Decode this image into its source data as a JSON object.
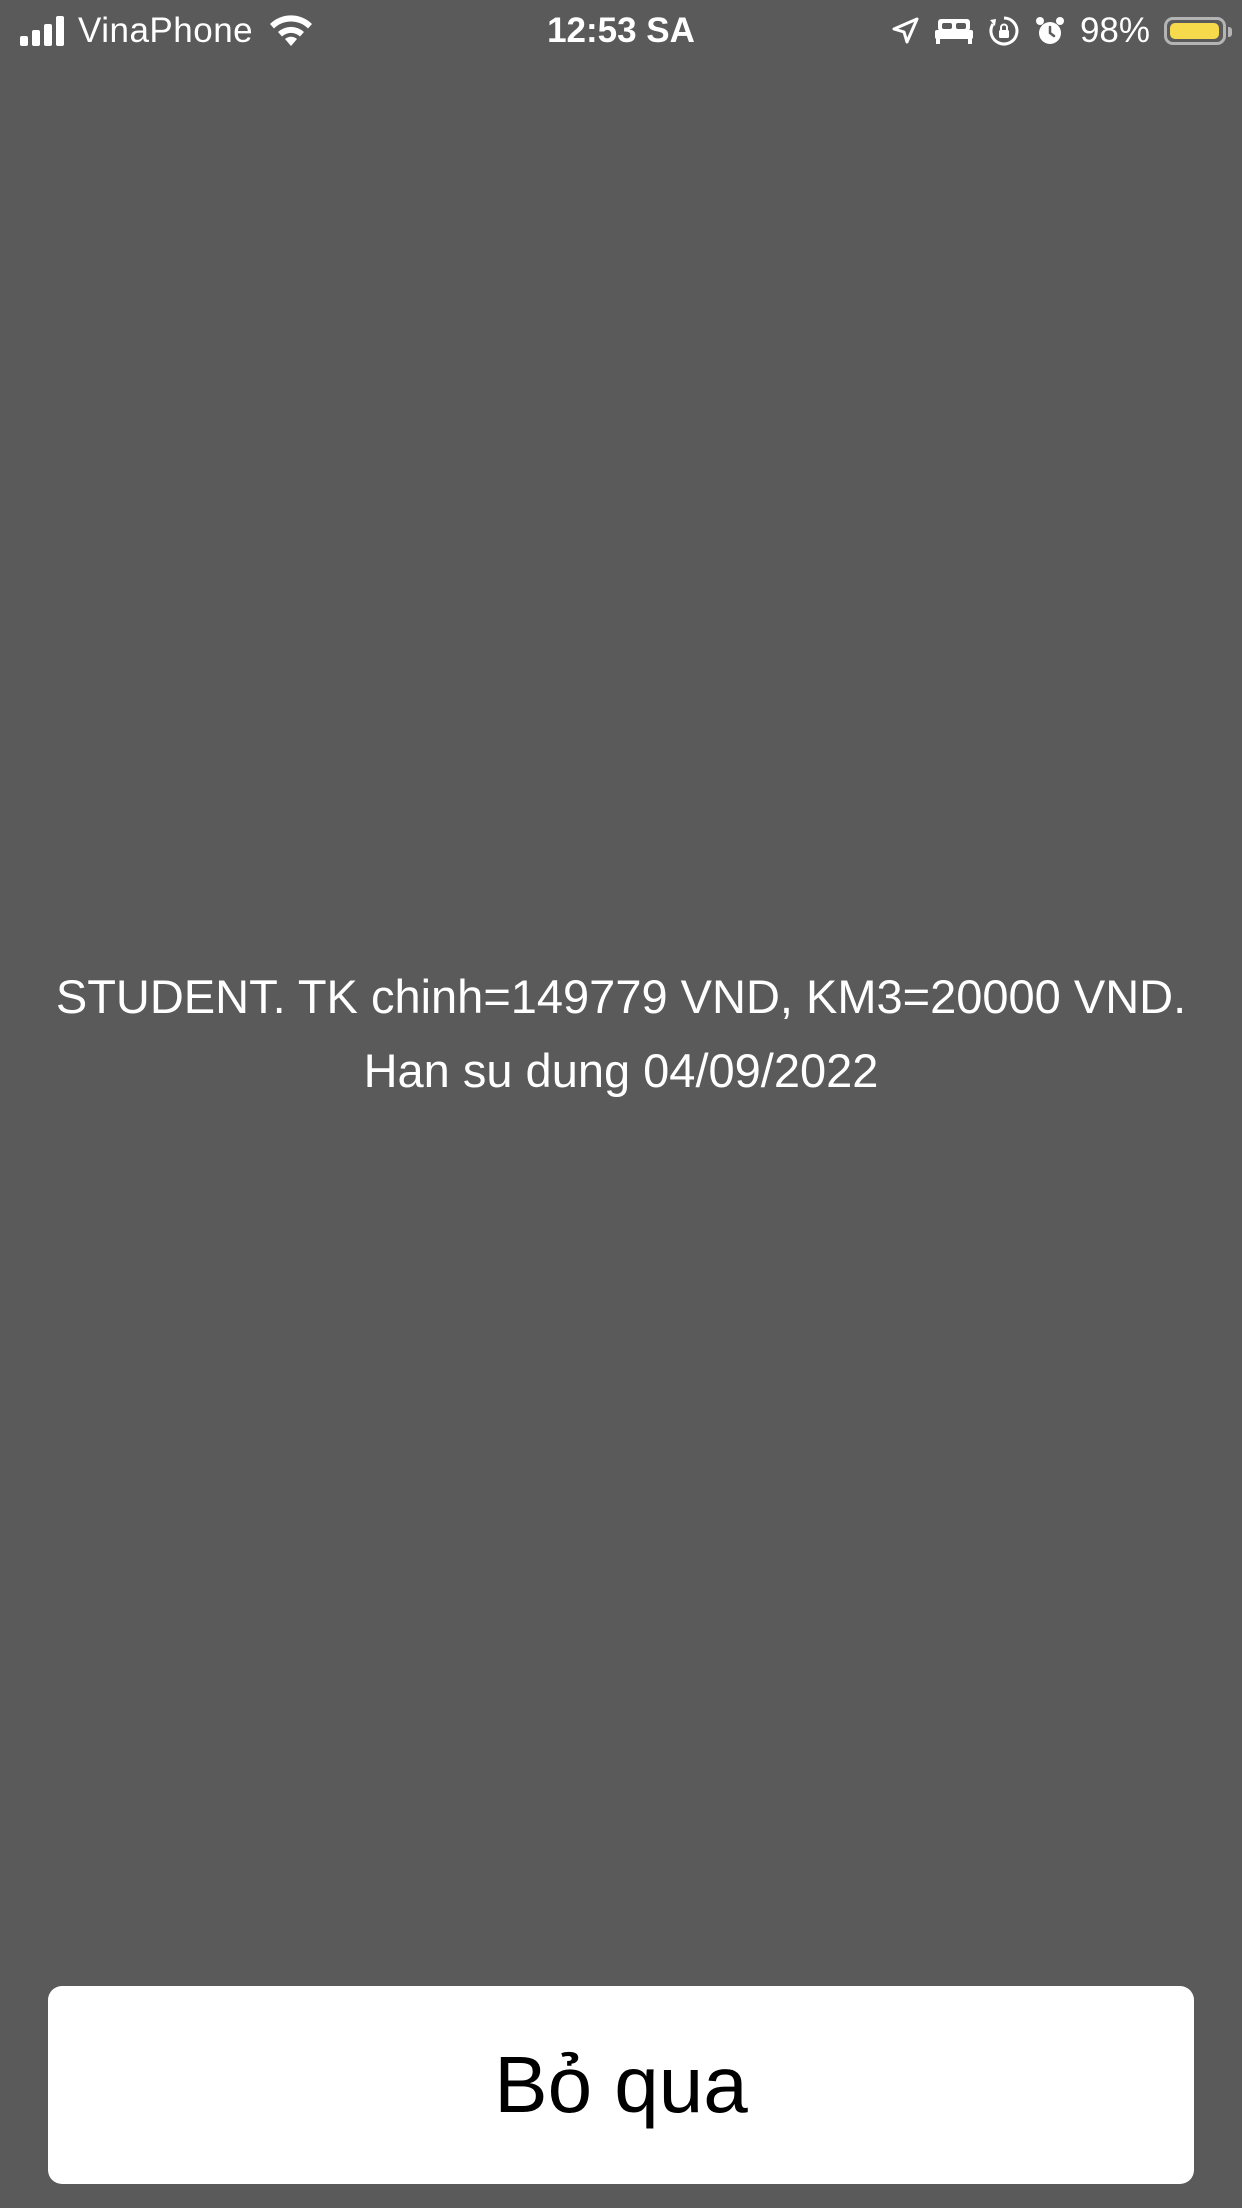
{
  "status_bar": {
    "carrier": "VinaPhone",
    "time": "12:53 SA",
    "battery_percent_text": "98%",
    "battery_level": 0.98,
    "battery_color": "#f7d94c",
    "icons": [
      "signal-icon",
      "wifi-icon",
      "location-icon",
      "sleep-bed-icon",
      "rotation-lock-icon",
      "alarm-icon",
      "battery-icon"
    ]
  },
  "message": {
    "text": "STUDENT. TK chinh=149779 VND, KM3=20000 VND. Han su dung 04/09/2022"
  },
  "actions": {
    "dismiss_label": "Bỏ qua"
  },
  "colors": {
    "background": "#5a5a5a",
    "button_background": "#ffffff",
    "text_on_background": "#ffffff"
  }
}
